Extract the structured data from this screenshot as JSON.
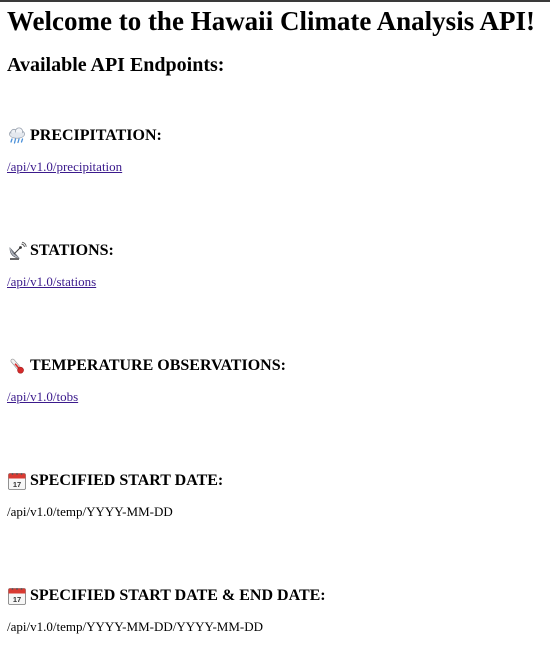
{
  "title": "Welcome to the Hawaii Climate Analysis API!",
  "subtitle": "Available API Endpoints:",
  "colors": {
    "link": "#3b1a8c",
    "text": "#000000",
    "background": "#ffffff"
  },
  "endpoints": [
    {
      "icon": "rain-cloud-icon",
      "label": "PRECIPITATION:",
      "path": "/api/v1.0/precipitation",
      "is_link": true
    },
    {
      "icon": "satellite-dish-icon",
      "label": "STATIONS:",
      "path": "/api/v1.0/stations",
      "is_link": true
    },
    {
      "icon": "thermometer-icon",
      "label": "TEMPERATURE OBSERVATIONS:",
      "path": "/api/v1.0/tobs",
      "is_link": true
    },
    {
      "icon": "calendar-icon",
      "label": "SPECIFIED START DATE:",
      "path": "/api/v1.0/temp/YYYY-MM-DD",
      "is_link": false
    },
    {
      "icon": "calendar-icon",
      "label": "SPECIFIED START DATE & END DATE:",
      "path": "/api/v1.0/temp/YYYY-MM-DD/YYYY-MM-DD",
      "is_link": false
    }
  ]
}
